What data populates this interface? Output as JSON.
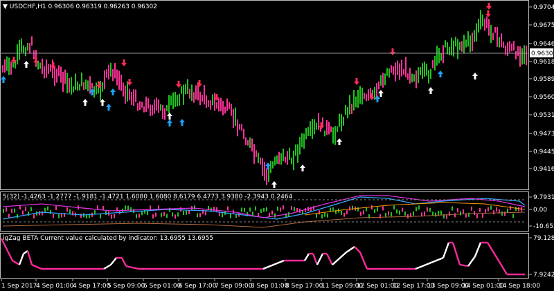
{
  "symbol_header": "▼ USDCHF,H1  0.96306 0.96319 0.96263 0.96302",
  "main": {
    "price_ticks": [
      "0.97041",
      "0.96756",
      "0.96466",
      "0.96181",
      "0.95897",
      "0.95601",
      "0.95316",
      "0.94733",
      "0.94451",
      "0.94161"
    ],
    "current_price": "0.96302"
  },
  "osc": {
    "header": "5(32) -1.4263 -1.2777 -1.9181 -1.4721 1.6080 1.6080 8.6179 6.4773 3.9380 -2.3943 0.2464",
    "ticks": [
      "9.7931",
      "0.00",
      "-10.6525"
    ]
  },
  "zigzag": {
    "header": "igZag BETA Current value calculated by indicator: 13.6955 13.6955",
    "ticks": [
      "79.1286",
      "7.9242"
    ]
  },
  "time_ticks": [
    "1 Sep 2017",
    "4 Sep 01:00",
    "4 Sep 17:00",
    "5 Sep 09:00",
    "6 Sep 01:00",
    "6 Sep 17:00",
    "7 Sep 09:00",
    "8 Sep 01:00",
    "8 Sep 17:00",
    "11 Sep 09:00",
    "12 Sep 01:00",
    "12 Sep 17:00",
    "13 Sep 09:00",
    "14 Sep 01:00",
    "14 Sep 18:00"
  ],
  "colors": {
    "bull": "#22c222",
    "bear": "#ff3399",
    "down_arrow": "#ff2a55",
    "up_arrow": "#1ea0ff",
    "white_arrow": "#ffffff",
    "osc_blue": "#33aaff",
    "osc_magenta": "#dd33dd",
    "osc_orange": "#ff9900",
    "osc_brown": "#b36a3a",
    "osc_gray": "#888888",
    "zigzag_pink": "#ff2a9a",
    "zigzag_white": "#ffffff"
  }
}
